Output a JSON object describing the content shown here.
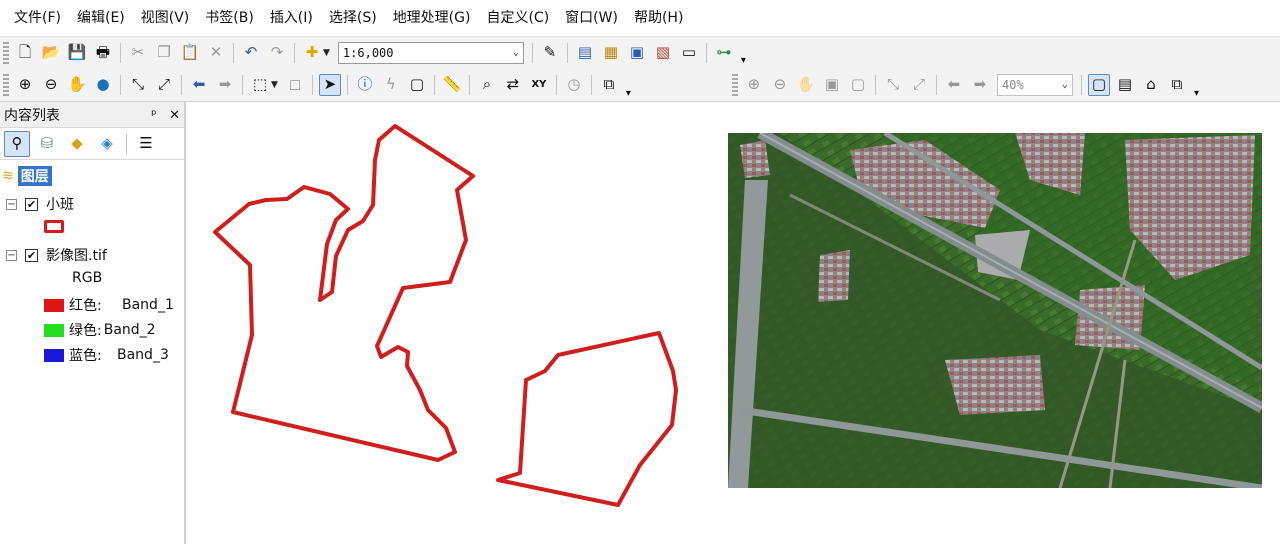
{
  "menubar": {
    "items": [
      "文件(F)",
      "编辑(E)",
      "视图(V)",
      "书签(B)",
      "插入(I)",
      "选择(S)",
      "地理处理(G)",
      "自定义(C)",
      "窗口(W)",
      "帮助(H)"
    ]
  },
  "toolbar": {
    "scale_value": "1:6,000",
    "zoom_value": "40%"
  },
  "toc": {
    "title": "内容列表",
    "pin_icon": "pin-icon",
    "close_icon": "close-icon",
    "group_label": "图层",
    "layer1": {
      "name": "小班",
      "checked": true,
      "symbol_color": "#d21d1d"
    },
    "layer2": {
      "name": "影像图.tif",
      "checked": true,
      "render": "RGB",
      "bands": [
        {
          "channel": "红色:",
          "band": "Band_1",
          "color": "#e01515"
        },
        {
          "channel": "绿色:",
          "band": "Band_2",
          "color": "#22dd22"
        },
        {
          "channel": "蓝色:",
          "band": "Band_3",
          "color": "#1a1ad6"
        }
      ]
    }
  },
  "map": {
    "polygon_stroke_color": "#d21d1d",
    "imagery_colors": {
      "field": "#3b6b2b",
      "road": "#8e949a",
      "village": "#a8979a"
    }
  }
}
